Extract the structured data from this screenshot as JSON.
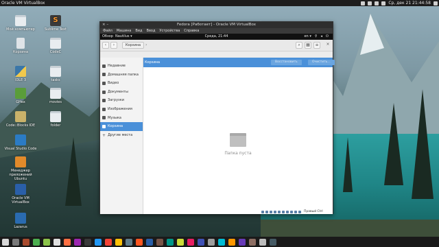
{
  "topbar": {
    "title": "Oracle VM VirtualBox",
    "datetime": "Ср, дек 21 21:44:58"
  },
  "desktop_icons": [
    {
      "label": "Мой компьютер",
      "icon": "folder-icon"
    },
    {
      "label": "Sublime Text",
      "icon": "sublime-text-icon"
    },
    {
      "label": "Корзина",
      "icon": "trash-icon"
    },
    {
      "label": "CodeC",
      "icon": "folder-icon"
    },
    {
      "label": "IDLE 3",
      "icon": "python-icon"
    },
    {
      "label": "tasks",
      "icon": "folder-icon"
    },
    {
      "label": "GHex",
      "icon": "ghex-icon"
    },
    {
      "label": "movies",
      "icon": "folder-icon"
    },
    {
      "label": "Code::Blocks IDE",
      "icon": "codeblocks-icon"
    },
    {
      "label": "folder",
      "icon": "folder-icon"
    },
    {
      "label": "Visual Studio Code",
      "icon": "vscode-icon"
    },
    {
      "label": "Менеджер приложений Ubuntu",
      "icon": "app-manager-icon"
    },
    {
      "label": "Oracle VM VirtualBox",
      "icon": "virtualbox-icon"
    },
    {
      "label": "Lazarus",
      "icon": "lazarus-icon"
    }
  ],
  "vbox_window": {
    "title": "Fedora [Работает] - Oracle VM VirtualBox",
    "menu": [
      "Файл",
      "Машина",
      "Вид",
      "Ввод",
      "Устройства",
      "Справка"
    ],
    "status_hostkey": "Правый Ctrl"
  },
  "guest": {
    "activities": "Обзор",
    "app": "Nautilus ▾",
    "clock": "Среда, 21:44",
    "lang": "en ▾"
  },
  "nautilus": {
    "breadcrumb": "Корзина",
    "sidebar": [
      {
        "label": "Недавние",
        "active": false
      },
      {
        "label": "Домашняя папка",
        "active": false
      },
      {
        "label": "Видео",
        "active": false
      },
      {
        "label": "Документы",
        "active": false
      },
      {
        "label": "Загрузки",
        "active": false
      },
      {
        "label": "Изображения",
        "active": false
      },
      {
        "label": "Музыка",
        "active": false
      },
      {
        "label": "Корзина",
        "active": true
      },
      {
        "label": "Другие места",
        "active": false
      }
    ],
    "trash_bar_label": "Корзина",
    "restore_btn": "Восстановить",
    "empty_btn": "Очистить...",
    "empty_text": "Папка пуста"
  },
  "colors": {
    "accent": "#4a90d9",
    "topbar": "#1d1d1d"
  }
}
